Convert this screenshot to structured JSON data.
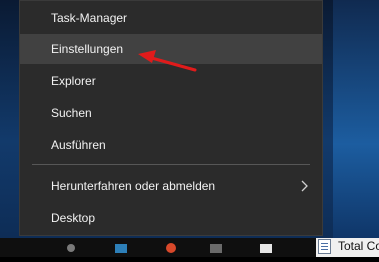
{
  "menu": {
    "items": [
      {
        "label": "Task-Manager"
      },
      {
        "label": "Einstellungen"
      },
      {
        "label": "Explorer"
      },
      {
        "label": "Suchen"
      },
      {
        "label": "Ausführen"
      },
      {
        "label": "Herunterfahren oder abmelden"
      },
      {
        "label": "Desktop"
      }
    ]
  },
  "taskbar": {
    "total_label": "Total Co"
  },
  "colors": {
    "menu_bg": "#2b2b2b",
    "hover_bg": "#414141",
    "text": "#f2f2f2",
    "annotation_arrow": "#e01b1b"
  }
}
